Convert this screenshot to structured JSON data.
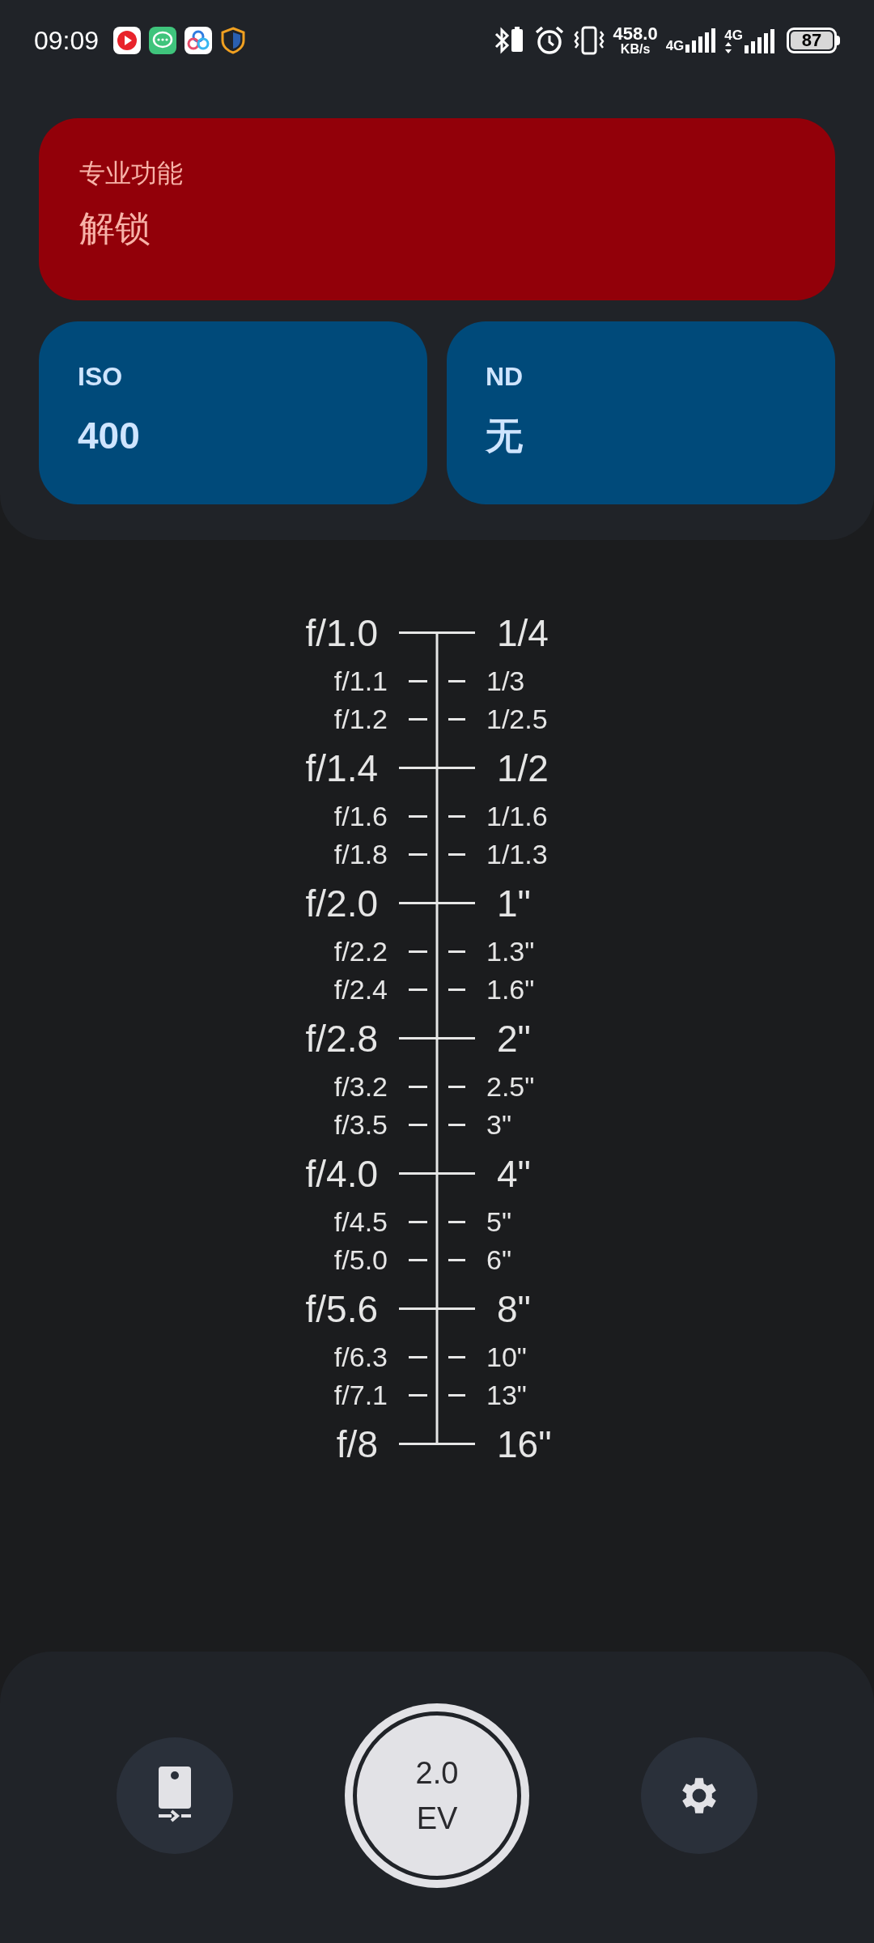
{
  "status_bar": {
    "time": "09:09",
    "net_speed": "458.0",
    "net_unit": "KB/s",
    "sims": [
      {
        "label": "4G"
      },
      {
        "label": "4G"
      }
    ],
    "battery": "87"
  },
  "cards": [
    {
      "kind": "pro",
      "label": "专业功能",
      "value": "解锁"
    },
    {
      "kind": "setting",
      "label": "ISO",
      "value": "400"
    },
    {
      "kind": "setting",
      "label": "ND",
      "value": "无"
    }
  ],
  "scale": [
    {
      "kind": "major",
      "aperture": "f/1.0",
      "shutter": "1/4"
    },
    {
      "kind": "minor",
      "aperture": "f/1.1",
      "shutter": "1/3"
    },
    {
      "kind": "minor",
      "aperture": "f/1.2",
      "shutter": "1/2.5"
    },
    {
      "kind": "major",
      "aperture": "f/1.4",
      "shutter": "1/2"
    },
    {
      "kind": "minor",
      "aperture": "f/1.6",
      "shutter": "1/1.6"
    },
    {
      "kind": "minor",
      "aperture": "f/1.8",
      "shutter": "1/1.3"
    },
    {
      "kind": "major",
      "aperture": "f/2.0",
      "shutter": "1\""
    },
    {
      "kind": "minor",
      "aperture": "f/2.2",
      "shutter": "1.3\""
    },
    {
      "kind": "minor",
      "aperture": "f/2.4",
      "shutter": "1.6\""
    },
    {
      "kind": "major",
      "aperture": "f/2.8",
      "shutter": "2\""
    },
    {
      "kind": "minor",
      "aperture": "f/3.2",
      "shutter": "2.5\""
    },
    {
      "kind": "minor",
      "aperture": "f/3.5",
      "shutter": "3\""
    },
    {
      "kind": "major",
      "aperture": "f/4.0",
      "shutter": "4\""
    },
    {
      "kind": "minor",
      "aperture": "f/4.5",
      "shutter": "5\""
    },
    {
      "kind": "minor",
      "aperture": "f/5.0",
      "shutter": "6\""
    },
    {
      "kind": "major",
      "aperture": "f/5.6",
      "shutter": "8\""
    },
    {
      "kind": "minor",
      "aperture": "f/6.3",
      "shutter": "10\""
    },
    {
      "kind": "minor",
      "aperture": "f/7.1",
      "shutter": "13\""
    },
    {
      "kind": "major",
      "aperture": "f/8",
      "shutter": "16\""
    }
  ],
  "ev_button": {
    "value": "2.0",
    "unit": "EV"
  }
}
